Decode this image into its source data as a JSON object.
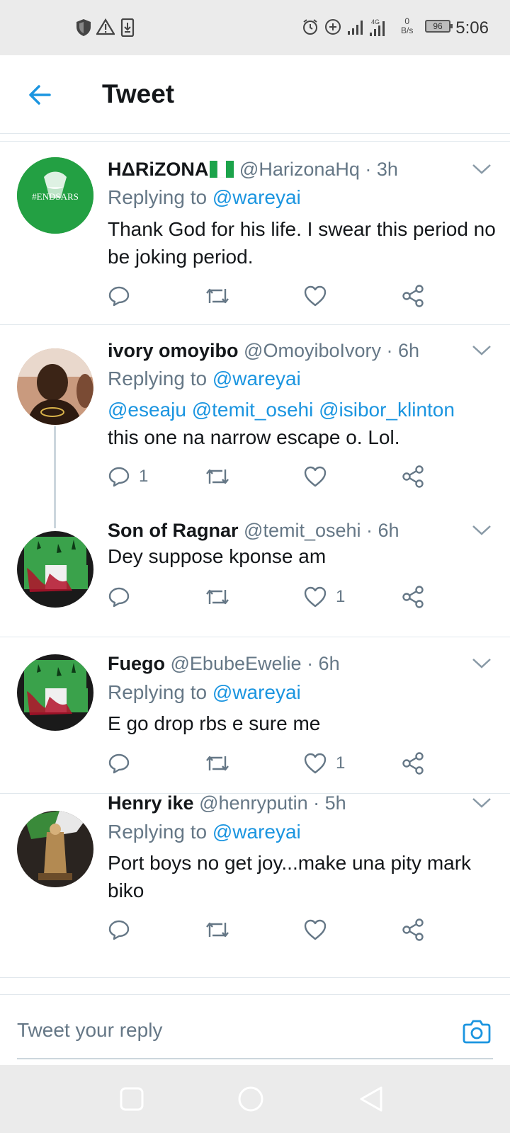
{
  "status_bar": {
    "time": "5:06",
    "battery": "96",
    "net_speed_value": "0",
    "net_speed_unit": "B/s",
    "network_type": "4G",
    "icons": [
      "shield-icon",
      "warning-icon",
      "download-icon",
      "alarm-icon",
      "data-saver-icon",
      "signal-icon",
      "signal-4g-icon",
      "battery-icon"
    ]
  },
  "header": {
    "title": "Tweet",
    "back_icon": "back-arrow-icon"
  },
  "tweets": [
    {
      "name": "HΔRiZONA",
      "flag": "nigeria-flag",
      "handle": "@HarizonaHq",
      "time": "· 3h",
      "replying_prefix": "Replying to",
      "replying_to": "@wareyai",
      "text": "Thank God for his life. I swear this period no be joking period.",
      "avatar_text": "#ENDSARS",
      "reply_count": "",
      "like_count": ""
    },
    {
      "name": "ivory omoyibo",
      "handle": "@OmoyiboIvory",
      "time": "· 6h",
      "replying_prefix": "Replying to",
      "replying_to": "@wareyai",
      "mentions": "@eseaju @temit_osehi @isibor_klinton",
      "text": "this one na narrow escape o. Lol.",
      "reply_count": "1",
      "like_count": ""
    },
    {
      "name": "Son of Ragnar",
      "handle": "@temit_osehi",
      "time": "· 6h",
      "text": "Dey suppose kponse am",
      "reply_count": "",
      "like_count": "1"
    },
    {
      "name": "Fuego",
      "handle": "@EbubeEwelie",
      "time": "· 6h",
      "replying_prefix": "Replying to",
      "replying_to": "@wareyai",
      "text": "E go drop rbs e sure me",
      "reply_count": "",
      "like_count": "1"
    },
    {
      "name": "Henry ike",
      "handle": "@henryputin",
      "time": "· 5h",
      "replying_prefix": "Replying to",
      "replying_to": "@wareyai",
      "text": "Port boys no get joy...make una pity mark biko",
      "reply_count": "",
      "like_count": ""
    }
  ],
  "reply_bar": {
    "placeholder": "Tweet your reply",
    "camera_icon": "camera-icon"
  },
  "nav_bar": {
    "buttons": [
      "recents-button",
      "home-button",
      "back-button"
    ]
  },
  "colors": {
    "accent": "#1b95e0",
    "text": "#14171a",
    "muted": "#657786",
    "divider": "#e1e8ed"
  }
}
